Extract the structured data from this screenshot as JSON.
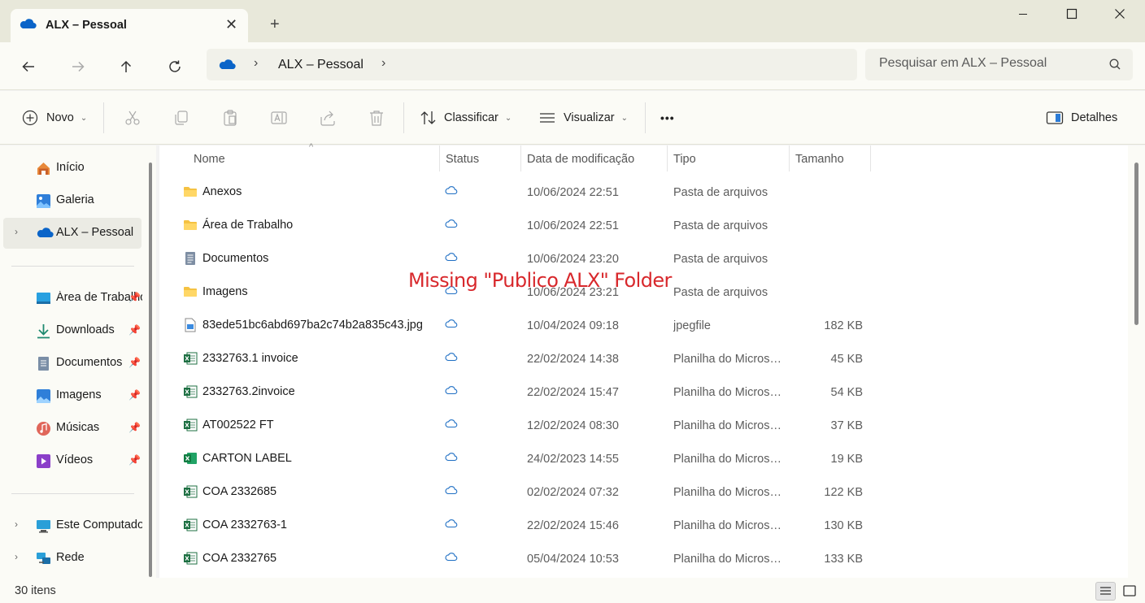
{
  "window": {
    "tab_title": "ALX – Pessoal",
    "new_tab": "+",
    "min": "—",
    "max": "☐",
    "close": "✕"
  },
  "address": {
    "crumb": "ALX – Pessoal",
    "sep": "›",
    "search_placeholder": "Pesquisar em ALX – Pessoal"
  },
  "toolbar": {
    "new_label": "Novo",
    "sort_label": "Classificar",
    "view_label": "Visualizar",
    "more": "•••",
    "details_label": "Detalhes"
  },
  "sidebar": {
    "top": [
      {
        "label": "Início",
        "icon": "home-icon"
      },
      {
        "label": "Galeria",
        "icon": "gallery-icon"
      },
      {
        "label": "ALX – Pessoal",
        "icon": "onedrive-icon"
      }
    ],
    "pinned": [
      {
        "label": "Área de Trabalho",
        "icon": "desktop-icon"
      },
      {
        "label": "Downloads",
        "icon": "downloads-icon"
      },
      {
        "label": "Documentos",
        "icon": "documents-icon"
      },
      {
        "label": "Imagens",
        "icon": "pictures-icon"
      },
      {
        "label": "Músicas",
        "icon": "music-icon"
      },
      {
        "label": "Vídeos",
        "icon": "videos-icon"
      }
    ],
    "bottom": [
      {
        "label": "Este Computador",
        "icon": "computer-icon"
      },
      {
        "label": "Rede",
        "icon": "network-icon"
      }
    ]
  },
  "columns": {
    "name": "Nome",
    "status": "Status",
    "date": "Data de modificação",
    "type": "Tipo",
    "size": "Tamanho"
  },
  "files": [
    {
      "name": "Anexos",
      "date": "10/06/2024 22:51",
      "type": "Pasta de arquivos",
      "size": "",
      "kind": "folder"
    },
    {
      "name": "Área de Trabalho",
      "date": "10/06/2024 22:51",
      "type": "Pasta de arquivos",
      "size": "",
      "kind": "folder"
    },
    {
      "name": "Documentos",
      "date": "10/06/2024 23:20",
      "type": "Pasta de arquivos",
      "size": "",
      "kind": "docs"
    },
    {
      "name": "Imagens",
      "date": "10/06/2024 23:21",
      "type": "Pasta de arquivos",
      "size": "",
      "kind": "folder"
    },
    {
      "name": "83ede51bc6abd697ba2c74b2a835c43.jpg",
      "date": "10/04/2024 09:18",
      "type": "jpegfile",
      "size": "182 KB",
      "kind": "image"
    },
    {
      "name": "2332763.1 invoice",
      "date": "22/02/2024 14:38",
      "type": "Planilha do Microsoft Excel",
      "size": "45 KB",
      "kind": "excel"
    },
    {
      "name": "2332763.2invoice",
      "date": "22/02/2024 15:47",
      "type": "Planilha do Microsoft Excel",
      "size": "54 KB",
      "kind": "excel"
    },
    {
      "name": "AT002522 FT",
      "date": "12/02/2024 08:30",
      "type": "Planilha do Microsoft Excel",
      "size": "37 KB",
      "kind": "excel"
    },
    {
      "name": "CARTON LABEL",
      "date": "24/02/2023 14:55",
      "type": "Planilha do Microsoft Excel",
      "size": "19 KB",
      "kind": "excel2"
    },
    {
      "name": "COA 2332685",
      "date": "02/02/2024 07:32",
      "type": "Planilha do Microsoft Excel",
      "size": "122 KB",
      "kind": "excel"
    },
    {
      "name": "COA 2332763-1",
      "date": "22/02/2024 15:46",
      "type": "Planilha do Microsoft Excel",
      "size": "130 KB",
      "kind": "excel"
    },
    {
      "name": "COA 2332765",
      "date": "05/04/2024 10:53",
      "type": "Planilha do Microsoft Excel",
      "size": "133 KB",
      "kind": "excel"
    }
  ],
  "annotation": "Missing \"Publico ALX\" Folder",
  "status": {
    "count": "30 itens"
  },
  "colors": {
    "accent": "#0067c0",
    "folder": "#f5c242",
    "excel": "#1d6f42",
    "annotation": "#d8282c"
  }
}
